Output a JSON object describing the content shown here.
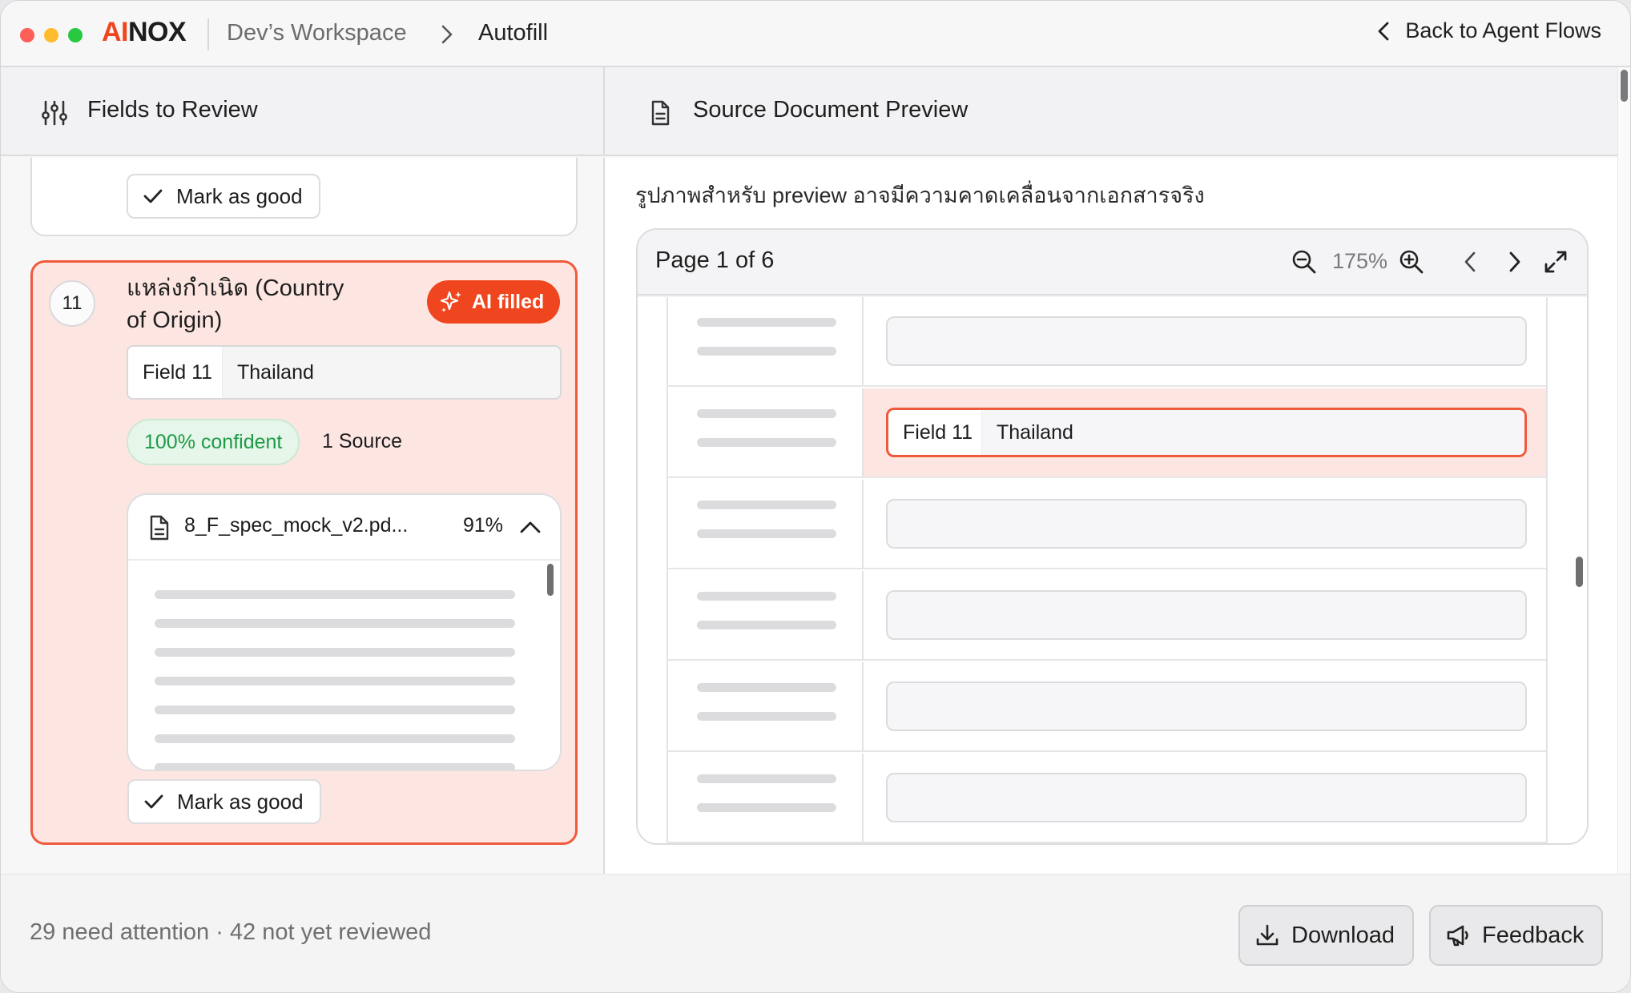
{
  "app": {
    "brand_accent": "AI",
    "brand_rest": "NOX",
    "workspace": "Dev’s Workspace",
    "page": "Autofill",
    "back_label": "Back to Agent Flows"
  },
  "colors": {
    "accent": "#f0441c",
    "confident_green": "#1f9a46",
    "active_card_bg": "#fde6e2",
    "active_border": "#ef5a3c"
  },
  "left_panel": {
    "title": "Fields to Review",
    "icon": "sliders-icon",
    "previous_card": {
      "mark_good_label": "Mark as good"
    },
    "active_card": {
      "number": "11",
      "title": "แหล่งกำเนิด (Country of Origin)",
      "ai_badge": "AI filled",
      "field_key": "Field 11",
      "field_value": "Thailand",
      "confidence": "100% confident",
      "source_count": "1 Source",
      "source": {
        "file_name": "8_F_spec_mock_v2.pd...",
        "match_pct": "91%"
      },
      "mark_good_label": "Mark as good"
    }
  },
  "right_panel": {
    "title": "Source Document Preview",
    "icon": "document-icon",
    "preview_note": "รูปภาพสำหรับ preview อาจมีความคาดเคลื่อนจากเอกสารจริง",
    "viewer": {
      "page_label": "Page 1 of 6",
      "zoom": "175%",
      "highlight_field_key": "Field 11",
      "highlight_field_value": "Thailand"
    }
  },
  "footer": {
    "status": "29 need attention · 42 not yet reviewed",
    "download_label": "Download",
    "feedback_label": "Feedback"
  }
}
